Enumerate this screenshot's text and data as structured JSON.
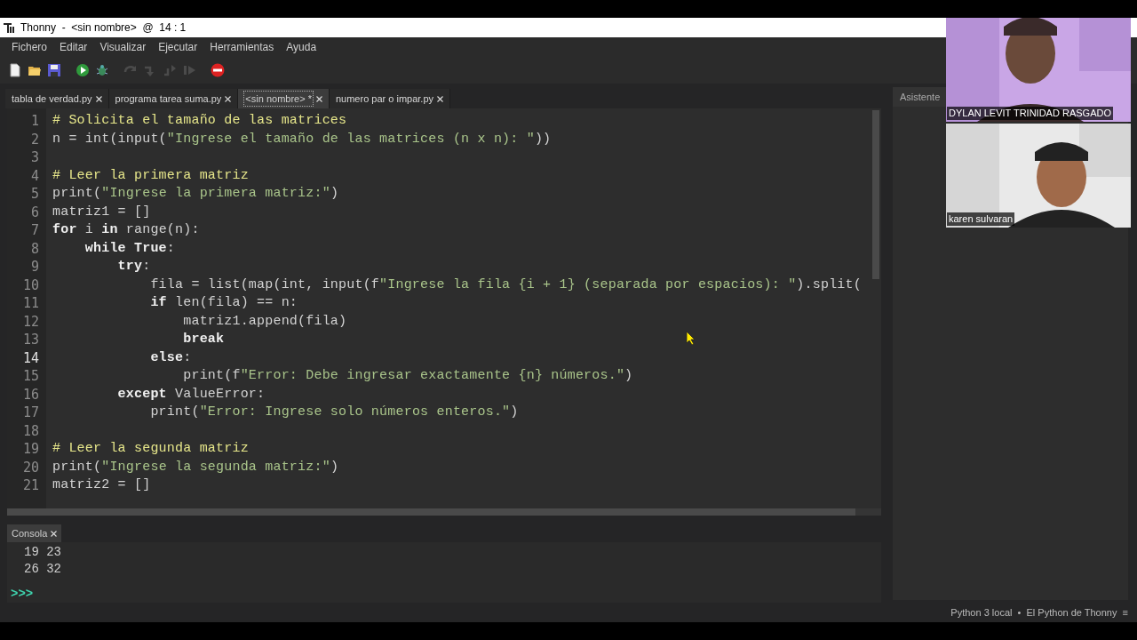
{
  "window": {
    "title": "Thonny  -  <sin nombre>  @  14 : 1"
  },
  "menu": [
    "Fichero",
    "Editar",
    "Visualizar",
    "Ejecutar",
    "Herramientas",
    "Ayuda"
  ],
  "toolbar": [
    {
      "kind": "new",
      "disabled": false
    },
    {
      "kind": "open",
      "disabled": false
    },
    {
      "kind": "save",
      "disabled": false
    },
    {
      "kind": "run",
      "disabled": false
    },
    {
      "kind": "debug",
      "disabled": false
    },
    {
      "kind": "step-over",
      "disabled": true
    },
    {
      "kind": "step-into",
      "disabled": true
    },
    {
      "kind": "step-out",
      "disabled": true
    },
    {
      "kind": "resume",
      "disabled": true
    },
    {
      "kind": "stop",
      "disabled": false
    }
  ],
  "tabs": [
    {
      "label": "tabla de verdad.py",
      "selected": false
    },
    {
      "label": "programa tarea suma.py",
      "selected": false
    },
    {
      "label": "<sin nombre> *",
      "selected": true
    },
    {
      "label": "numero par o impar.py",
      "selected": false
    }
  ],
  "editor": {
    "lines": [
      {
        "number": "1",
        "current": false,
        "tokens": [
          {
            "kind": "comment",
            "text": "# Solicita el tamaño de las matrices"
          }
        ]
      },
      {
        "number": "2",
        "current": false,
        "tokens": [
          {
            "kind": "plain",
            "text": "n = int(input("
          },
          {
            "kind": "string",
            "text": "\"Ingrese el tamaño de las matrices (n x n): \""
          },
          {
            "kind": "plain",
            "text": "))"
          }
        ]
      },
      {
        "number": "3",
        "current": false
      },
      {
        "number": "4",
        "current": false,
        "tokens": [
          {
            "kind": "comment",
            "text": "# Leer la primera matriz"
          }
        ]
      },
      {
        "number": "5",
        "current": false,
        "tokens": [
          {
            "kind": "plain",
            "text": "print("
          },
          {
            "kind": "string",
            "text": "\"Ingrese la primera matriz:\""
          },
          {
            "kind": "plain",
            "text": ")"
          }
        ]
      },
      {
        "number": "6",
        "current": false,
        "tokens": [
          {
            "kind": "plain",
            "text": "matriz1 = []"
          }
        ]
      },
      {
        "number": "7",
        "current": false,
        "tokens": [
          {
            "kind": "keyword",
            "text": "for"
          },
          {
            "kind": "plain",
            "text": " i "
          },
          {
            "kind": "keyword",
            "text": "in"
          },
          {
            "kind": "plain",
            "text": " range(n):"
          }
        ]
      },
      {
        "number": "8",
        "current": false,
        "tokens": [
          {
            "kind": "keyword",
            "text": "    while True"
          },
          {
            "kind": "plain",
            "text": ":"
          }
        ]
      },
      {
        "number": "9",
        "current": false,
        "tokens": [
          {
            "kind": "keyword",
            "text": "        try"
          },
          {
            "kind": "plain",
            "text": ":"
          }
        ]
      },
      {
        "number": "10",
        "current": false,
        "tokens": [
          {
            "kind": "plain",
            "text": "            fila = list(map(int, input(f"
          },
          {
            "kind": "string",
            "text": "\"Ingrese la fila {i + 1} (separada por espacios): \""
          },
          {
            "kind": "plain",
            "text": ").split("
          }
        ]
      },
      {
        "number": "11",
        "current": false,
        "tokens": [
          {
            "kind": "keyword",
            "text": "            if"
          },
          {
            "kind": "plain",
            "text": " len(fila) == n:"
          }
        ]
      },
      {
        "number": "12",
        "current": false,
        "tokens": [
          {
            "kind": "plain",
            "text": "                matriz1.append(fila)"
          }
        ]
      },
      {
        "number": "13",
        "current": false,
        "tokens": [
          {
            "kind": "keyword",
            "text": "                break"
          }
        ]
      },
      {
        "number": "14",
        "current": true,
        "tokens": [
          {
            "kind": "keyword",
            "text": "            else"
          },
          {
            "kind": "plain",
            "text": ":"
          }
        ]
      },
      {
        "number": "15",
        "current": false,
        "tokens": [
          {
            "kind": "plain",
            "text": "                print(f"
          },
          {
            "kind": "string",
            "text": "\"Error: Debe ingresar exactamente {n} números.\""
          },
          {
            "kind": "plain",
            "text": ")"
          }
        ]
      },
      {
        "number": "16",
        "current": false,
        "tokens": [
          {
            "kind": "keyword",
            "text": "        except"
          },
          {
            "kind": "plain",
            "text": " ValueError:"
          }
        ]
      },
      {
        "number": "17",
        "current": false,
        "tokens": [
          {
            "kind": "plain",
            "text": "            print("
          },
          {
            "kind": "string",
            "text": "\"Error: Ingrese solo números enteros.\""
          },
          {
            "kind": "plain",
            "text": ")"
          }
        ]
      },
      {
        "number": "18",
        "current": false
      },
      {
        "number": "19",
        "current": false,
        "tokens": [
          {
            "kind": "comment",
            "text": "# Leer la segunda matriz"
          }
        ]
      },
      {
        "number": "20",
        "current": false,
        "tokens": [
          {
            "kind": "plain",
            "text": "print("
          },
          {
            "kind": "string",
            "text": "\"Ingrese la segunda matriz:\""
          },
          {
            "kind": "plain",
            "text": ")"
          }
        ]
      },
      {
        "number": "21",
        "current": false,
        "tokens": [
          {
            "kind": "plain",
            "text": "matriz2 = []"
          }
        ]
      }
    ]
  },
  "assistant": {
    "title": "Asistente"
  },
  "participants": [
    {
      "kind": "picture",
      "name": "DYLAN LEVIT TRINIDAD RASGADO"
    },
    {
      "kind": "picture",
      "name": "karen sulvaran"
    }
  ],
  "console": {
    "title": "Consola",
    "output": [
      "19 23",
      "26 32"
    ],
    "prompt": ">>>"
  },
  "status_bar": "Python 3 local  •  El Python de Thonny  ≡"
}
